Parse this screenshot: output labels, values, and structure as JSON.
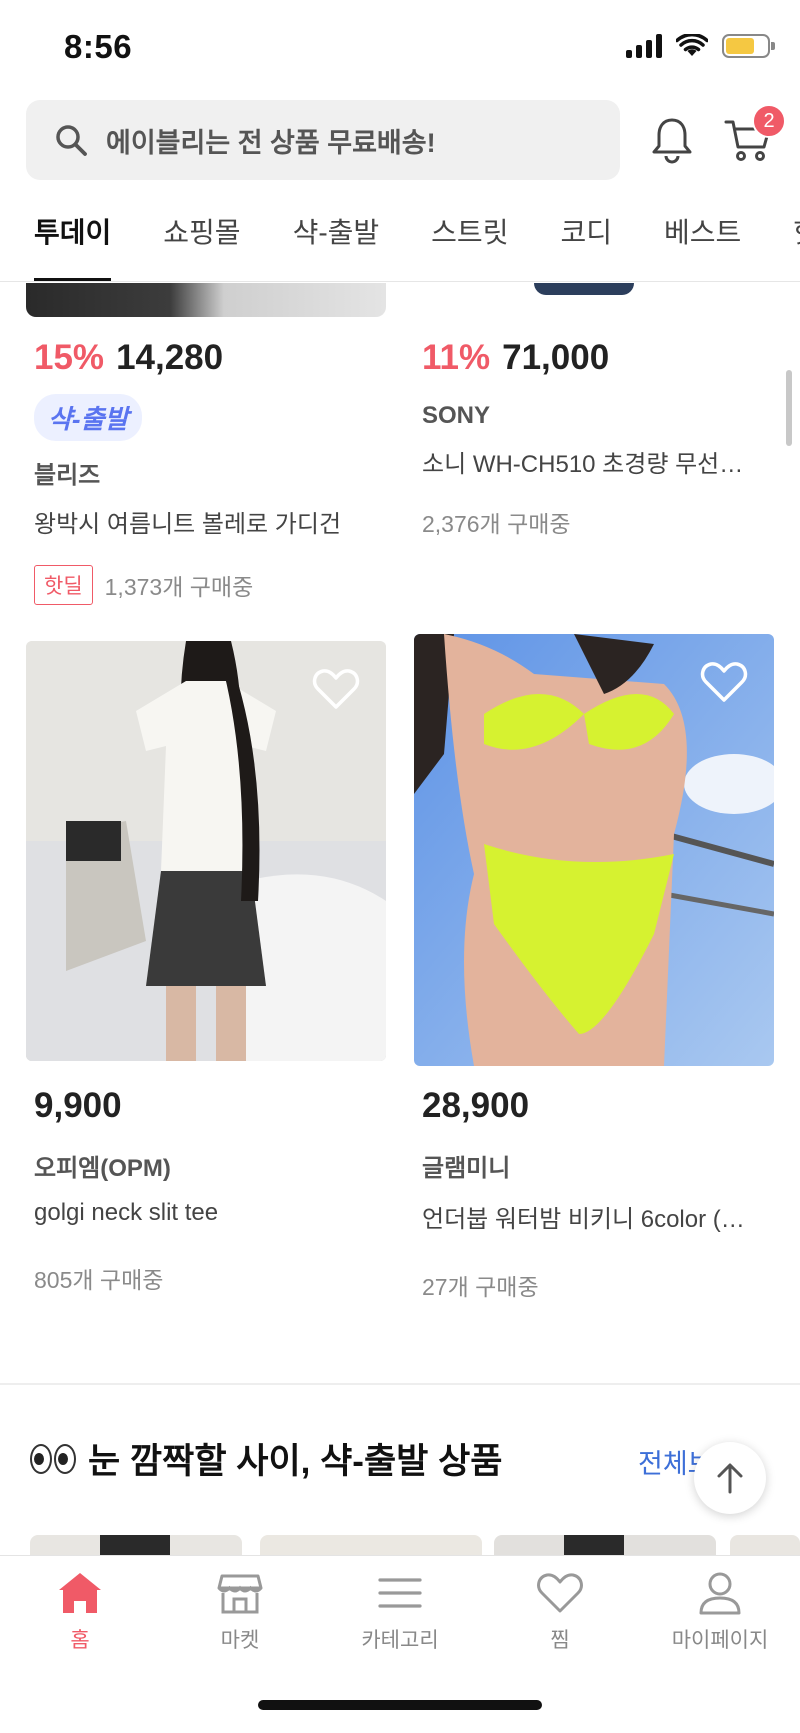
{
  "status_bar": {
    "time": "8:56"
  },
  "header": {
    "search_placeholder": "에이블리는 전 상품 무료배송!",
    "cart_count": "2"
  },
  "tabs": [
    {
      "label": "투데이",
      "active": true
    },
    {
      "label": "쇼핑몰"
    },
    {
      "label": "샥-출발"
    },
    {
      "label": "스트릿"
    },
    {
      "label": "코디"
    },
    {
      "label": "베스트"
    },
    {
      "label": "핫"
    }
  ],
  "products_top": [
    {
      "discount": "15%",
      "price": "14,280",
      "chip": "샥-출발",
      "brand": "블리즈",
      "name": "왕박시 여름니트 볼레로 가디건",
      "hot_badge": "핫딜",
      "purchases": "1,373개 구매중"
    },
    {
      "discount": "11%",
      "price": "71,000",
      "brand": "SONY",
      "name": "소니 WH-CH510 초경량 무선…",
      "purchases": "2,376개 구매중"
    }
  ],
  "products_bottom": [
    {
      "price": "9,900",
      "brand": "오피엠(OPM)",
      "name": "golgi neck slit tee",
      "purchases": "805개 구매중"
    },
    {
      "price": "28,900",
      "brand": "글램미니",
      "name": "언더붑 워터밤 비키니 6color (…",
      "purchases": "27개 구매중"
    }
  ],
  "section": {
    "title": "눈 깜짝할 사이, 샥-출발 상품",
    "see_all": "전체보기"
  },
  "bottom_nav": [
    {
      "label": "홈",
      "icon": "home-icon",
      "active": true
    },
    {
      "label": "마켓",
      "icon": "store-icon"
    },
    {
      "label": "카테고리",
      "icon": "menu-icon"
    },
    {
      "label": "찜",
      "icon": "heart-icon"
    },
    {
      "label": "마이페이지",
      "icon": "person-icon"
    }
  ],
  "colors": {
    "accent": "#f05a67",
    "chip_bg": "#ecf0ff",
    "chip_text": "#5a74f0",
    "link": "#3d6fd8"
  }
}
